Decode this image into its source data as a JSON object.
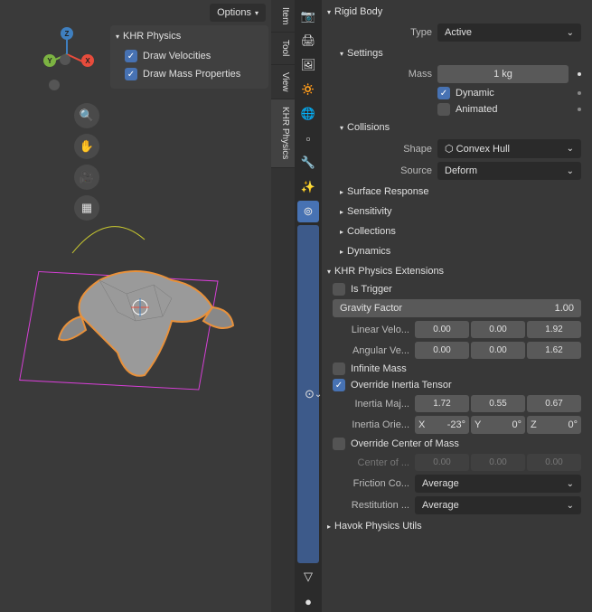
{
  "viewport": {
    "options_label": "Options",
    "panel_title": "KHR Physics",
    "draw_velocities": "Draw Velocities",
    "draw_mass_props": "Draw Mass Properties",
    "axes": {
      "x": "X",
      "y": "Y",
      "z": "Z"
    }
  },
  "vtabs": [
    "Item",
    "Tool",
    "View",
    "KHR Physics"
  ],
  "props": {
    "rigid_body": "Rigid Body",
    "type_label": "Type",
    "type_value": "Active",
    "settings": "Settings",
    "mass_label": "Mass",
    "mass_value": "1 kg",
    "dynamic": "Dynamic",
    "animated": "Animated",
    "collisions": "Collisions",
    "shape_label": "Shape",
    "shape_value": "Convex Hull",
    "source_label": "Source",
    "source_value": "Deform",
    "surf_resp": "Surface Response",
    "sensitivity": "Sensitivity",
    "collections": "Collections",
    "dynamics": "Dynamics",
    "khr_ext": "KHR Physics Extensions",
    "is_trigger": "Is Trigger",
    "gravity_factor": "Gravity Factor",
    "gravity_value": "1.00",
    "lin_vel": "Linear Velo...",
    "lin_vals": [
      "0.00",
      "0.00",
      "1.92"
    ],
    "ang_vel": "Angular Ve...",
    "ang_vals": [
      "0.00",
      "0.00",
      "1.62"
    ],
    "inf_mass": "Infinite Mass",
    "override_inertia": "Override Inertia Tensor",
    "inertia_maj": "Inertia Maj...",
    "inertia_vals": [
      "1.72",
      "0.55",
      "0.67"
    ],
    "inertia_ori": "Inertia Orie...",
    "ori_vals": {
      "xl": "X",
      "xv": "-23°",
      "yl": "Y",
      "yv": "0°",
      "zl": "Z",
      "zv": "0°"
    },
    "override_com": "Override Center of Mass",
    "com_label": "Center of ...",
    "com_vals": [
      "0.00",
      "0.00",
      "0.00"
    ],
    "friction": "Friction Co...",
    "friction_val": "Average",
    "restitution": "Restitution ...",
    "restitution_val": "Average",
    "havok": "Havok Physics Utils"
  }
}
